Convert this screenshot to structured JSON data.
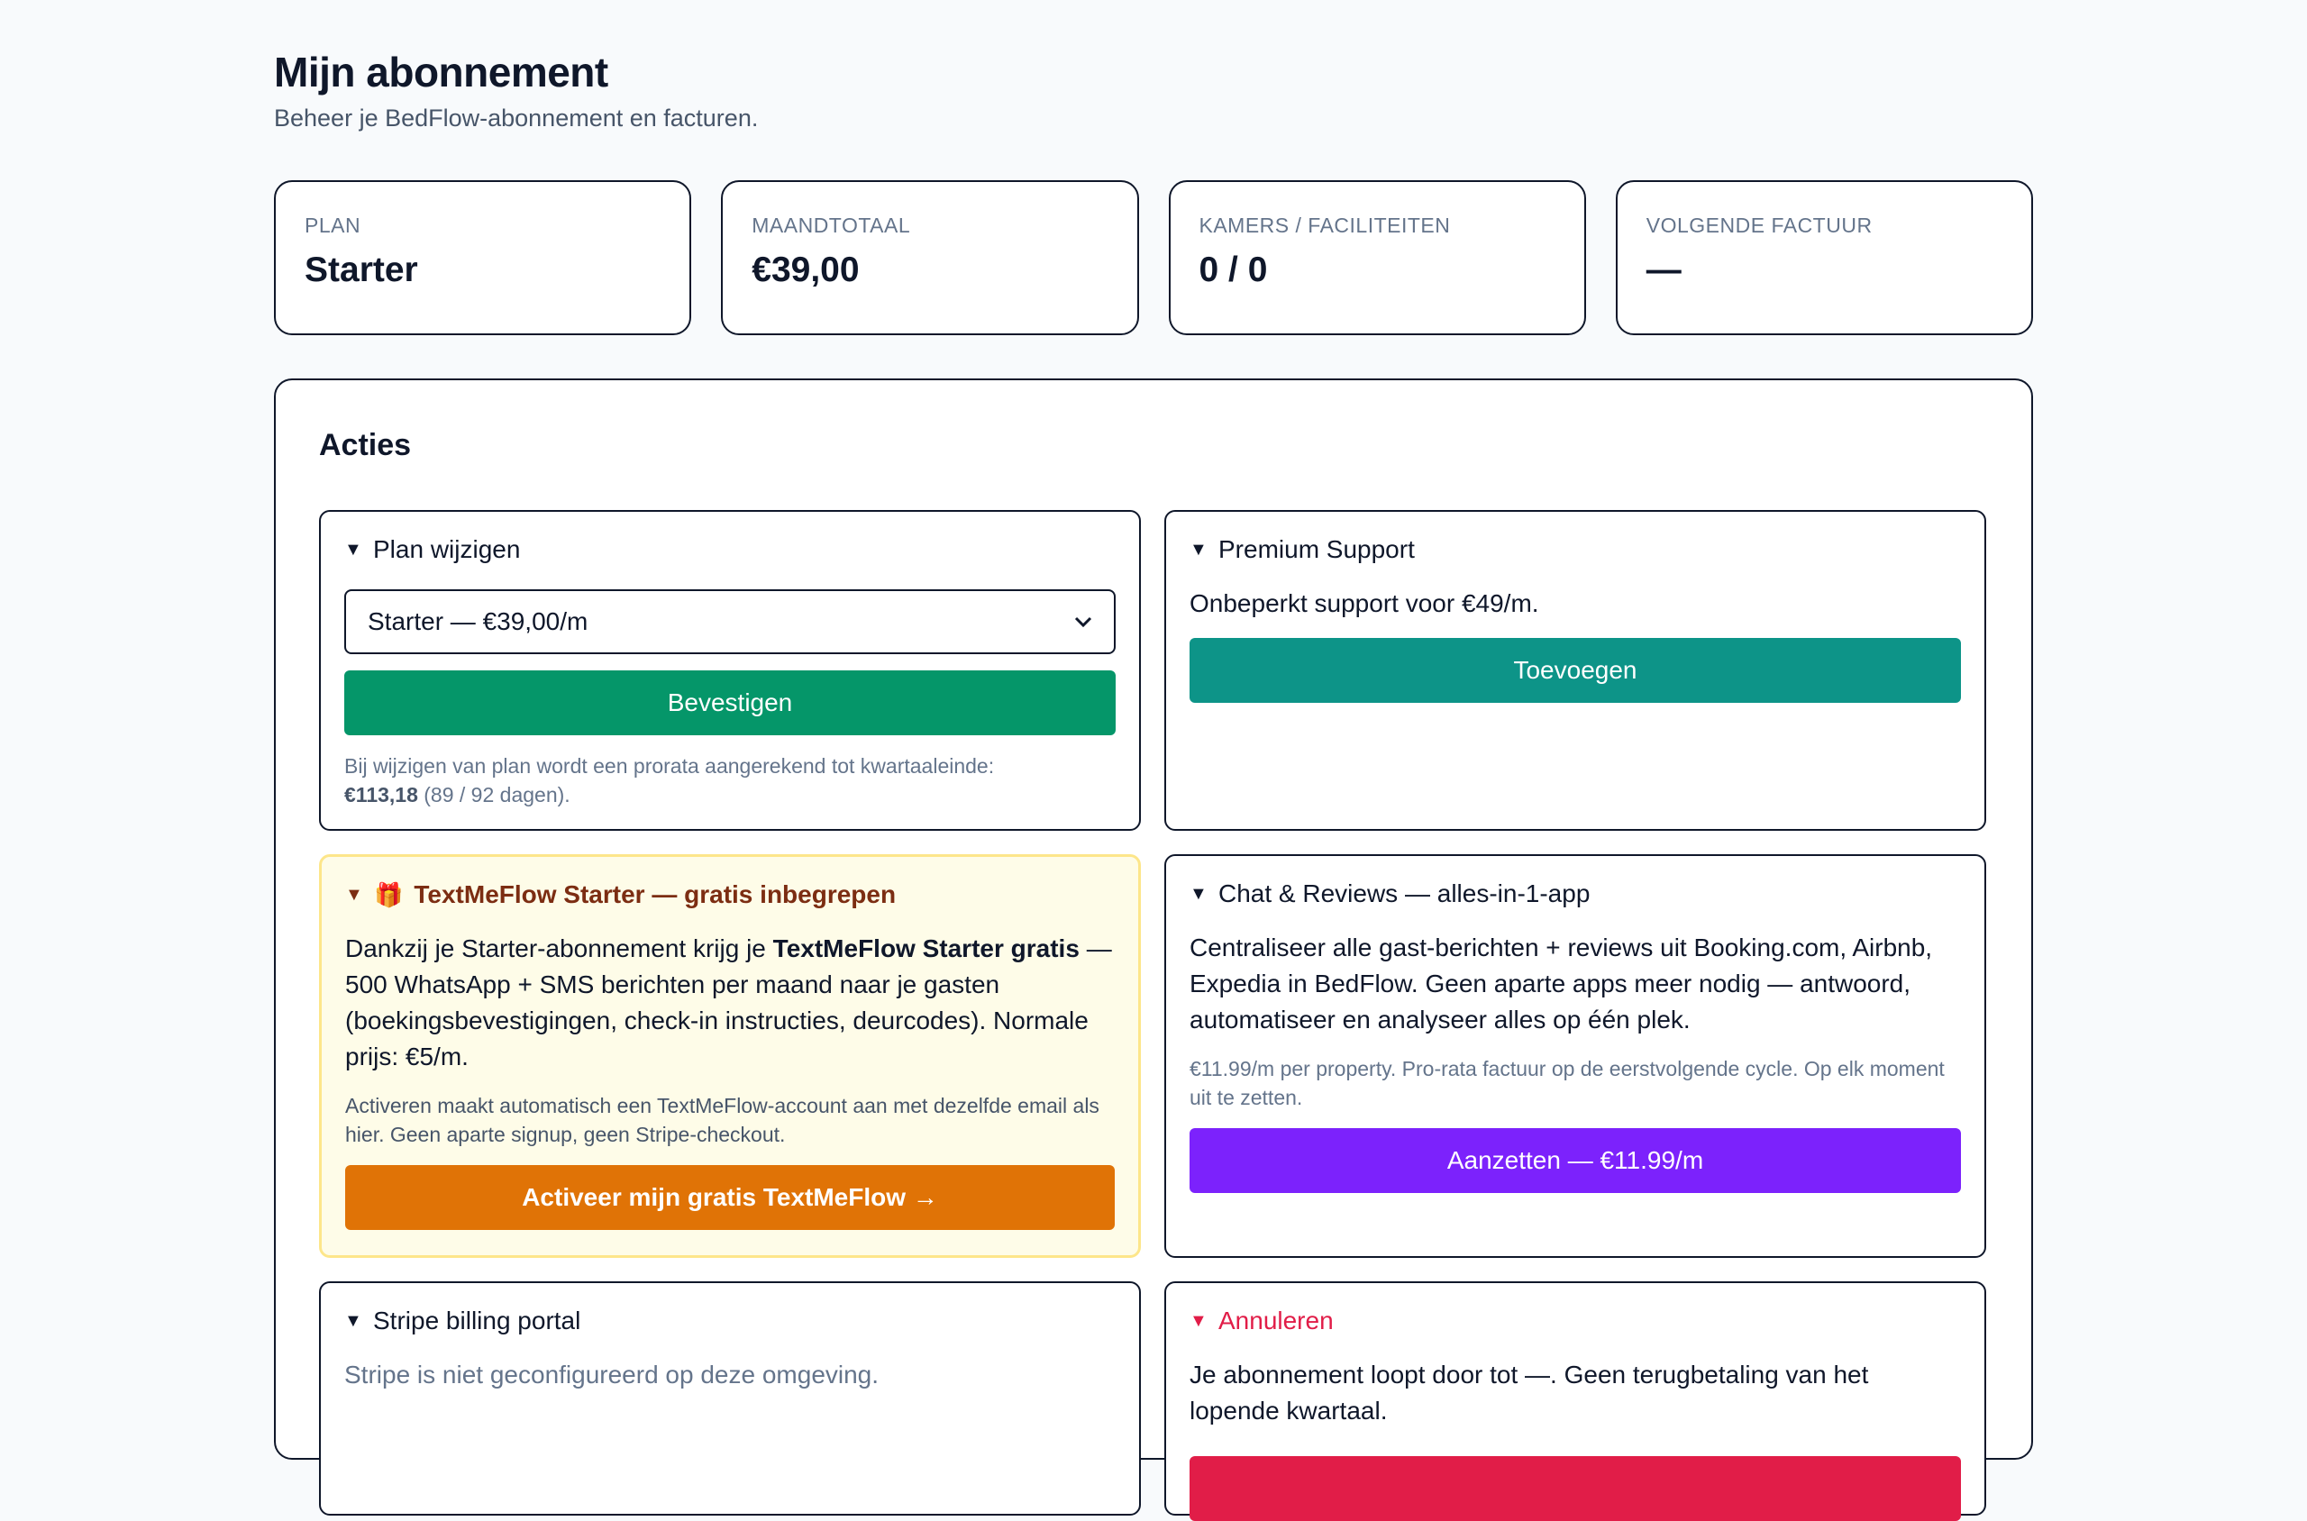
{
  "header": {
    "title": "Mijn abonnement",
    "subtitle": "Beheer je BedFlow-abonnement en facturen."
  },
  "stats": [
    {
      "label": "PLAN",
      "value": "Starter"
    },
    {
      "label": "MAANDTOTAAL",
      "value": "€39,00"
    },
    {
      "label": "KAMERS / FACILITEITEN",
      "value": "0 / 0"
    },
    {
      "label": "VOLGENDE FACTUUR",
      "value": "—"
    }
  ],
  "actions": {
    "title": "Acties",
    "plan_change": {
      "title": "Plan wijzigen",
      "select_value": "Starter — €39,00/m",
      "button": "Bevestigen",
      "note_prefix": "Bij wijzigen van plan wordt een prorata aangerekend tot kwartaaleinde:",
      "note_amount": "€113,18",
      "note_suffix": "(89 / 92 dagen)."
    },
    "premium_support": {
      "title": "Premium Support",
      "text": "Onbeperkt support voor €49/m.",
      "button": "Toevoegen"
    },
    "textmeflow": {
      "title": "TextMeFlow Starter — gratis inbegrepen",
      "text_prefix": "Dankzij je Starter-abonnement krijg je",
      "text_bold": "TextMeFlow Starter gratis",
      "text_suffix": "— 500 WhatsApp + SMS berichten per maand naar je gasten (boekingsbevestigingen, check-in instructies, deurcodes). Normale prijs: €5/m.",
      "note": "Activeren maakt automatisch een TextMeFlow-account aan met dezelfde email als hier. Geen aparte signup, geen Stripe-checkout.",
      "button": "Activeer mijn gratis TextMeFlow →"
    },
    "chat_reviews": {
      "title": "Chat & Reviews — alles-in-1-app",
      "text": "Centraliseer alle gast-berichten + reviews uit Booking.com, Airbnb, Expedia in BedFlow. Geen aparte apps meer nodig — antwoord, automatiseer en analyseer alles op één plek.",
      "note": "€11.99/m per property. Pro-rata factuur op de eerstvolgende cycle. Op elk moment uit te zetten.",
      "button": "Aanzetten — €11.99/m"
    },
    "stripe_portal": {
      "title": "Stripe billing portal",
      "text": "Stripe is niet geconfigureerd op deze omgeving."
    },
    "cancel": {
      "title": "Annuleren",
      "text": "Je abonnement loopt door tot —. Geen terugbetaling van het lopende kwartaal."
    }
  },
  "colors": {
    "green": "#059669",
    "teal": "#0d9488",
    "orange": "#e07306",
    "purple": "#7c22fc",
    "danger": "#e11d48"
  }
}
